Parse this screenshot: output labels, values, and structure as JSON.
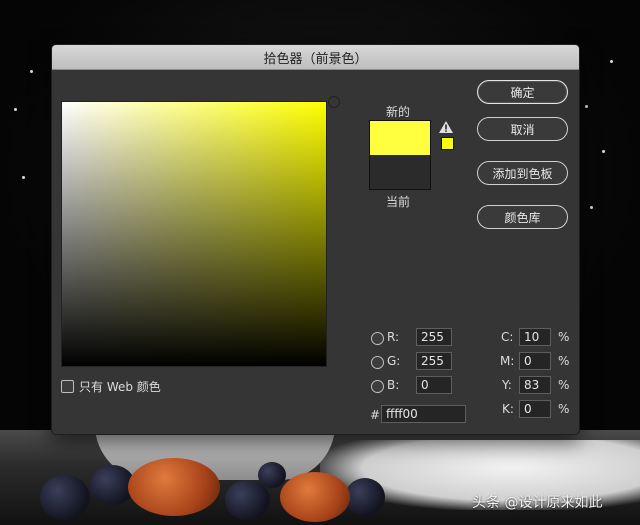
{
  "dialog": {
    "title": "拾色器（前景色）",
    "new_label": "新的",
    "current_label": "当前",
    "new_color": "#ffff40",
    "current_color": "#2b2b2b",
    "web_safe_color": "#ffff00",
    "only_web_label": "只有 Web 颜色",
    "buttons": {
      "ok": "确定",
      "cancel": "取消",
      "add_swatch": "添加到色板",
      "color_library": "颜色库"
    },
    "rgb": {
      "r_label": "R:",
      "r_value": "255",
      "g_label": "G:",
      "g_value": "255",
      "b_label": "B:",
      "b_value": "0"
    },
    "cmyk": {
      "c_label": "C:",
      "c_value": "10",
      "m_label": "M:",
      "m_value": "0",
      "y_label": "Y:",
      "y_value": "83",
      "k_label": "K:",
      "k_value": "0",
      "unit": "%"
    },
    "hex": {
      "label": "#",
      "value": "ffff00"
    }
  },
  "watermark": "头条 @设计原来如此",
  "icons": [
    "warning-icon"
  ]
}
